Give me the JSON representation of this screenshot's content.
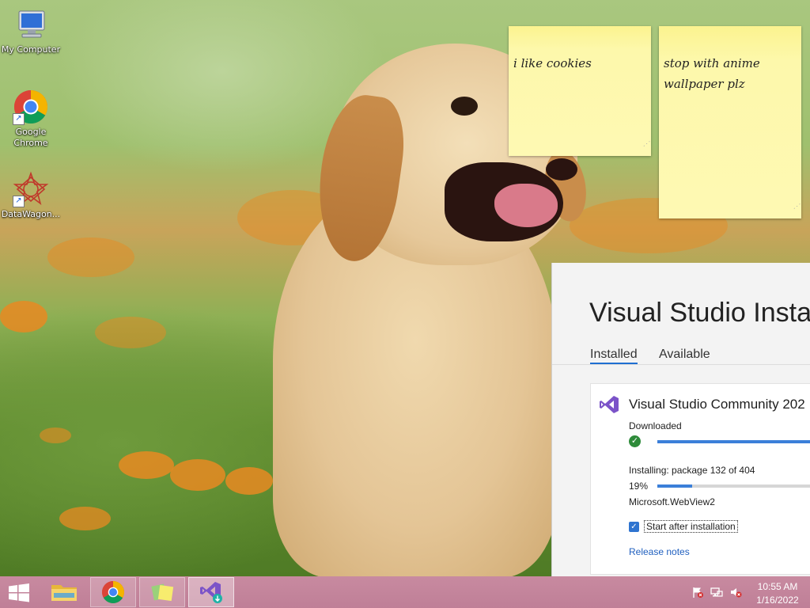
{
  "desktop": {
    "icons": [
      {
        "label": "My Computer",
        "icon": "computer-icon"
      },
      {
        "label": "Google Chrome",
        "icon": "chrome-icon"
      },
      {
        "label": "DataWagon...",
        "icon": "datawagon-icon"
      }
    ]
  },
  "sticky_notes": [
    {
      "text": "i like cookies"
    },
    {
      "text": "stop with anime wallpaper plz"
    }
  ],
  "installer": {
    "title": "Visual Studio Insta",
    "tabs": [
      {
        "label": "Installed",
        "active": true
      },
      {
        "label": "Available",
        "active": false
      }
    ],
    "product": {
      "name": "Visual Studio Community 202",
      "download_status": "Downloaded",
      "download_progress": 1.0,
      "install_status": "Installing: package 132 of 404",
      "install_percent_label": "19%",
      "install_progress": 0.19,
      "current_package": "Microsoft.WebView2",
      "start_after_install_label": "Start after installation",
      "start_after_install_checked": true,
      "release_notes_label": "Release notes"
    },
    "accent_color": "#3b7fd9"
  },
  "taskbar": {
    "buttons": [
      {
        "name": "start-button",
        "icon": "windows-logo-icon"
      },
      {
        "name": "file-explorer-button",
        "icon": "folder-icon"
      },
      {
        "name": "chrome-taskbar-button",
        "icon": "chrome-icon"
      },
      {
        "name": "sticky-notes-taskbar-button",
        "icon": "sticky-notes-icon"
      },
      {
        "name": "vs-installer-taskbar-button",
        "icon": "vs-installer-icon"
      }
    ],
    "tray": [
      {
        "icon": "action-center-flag-icon"
      },
      {
        "icon": "network-icon"
      },
      {
        "icon": "volume-muted-icon"
      }
    ],
    "clock": {
      "time": "10:55 AM",
      "date": "1/16/2022"
    }
  }
}
